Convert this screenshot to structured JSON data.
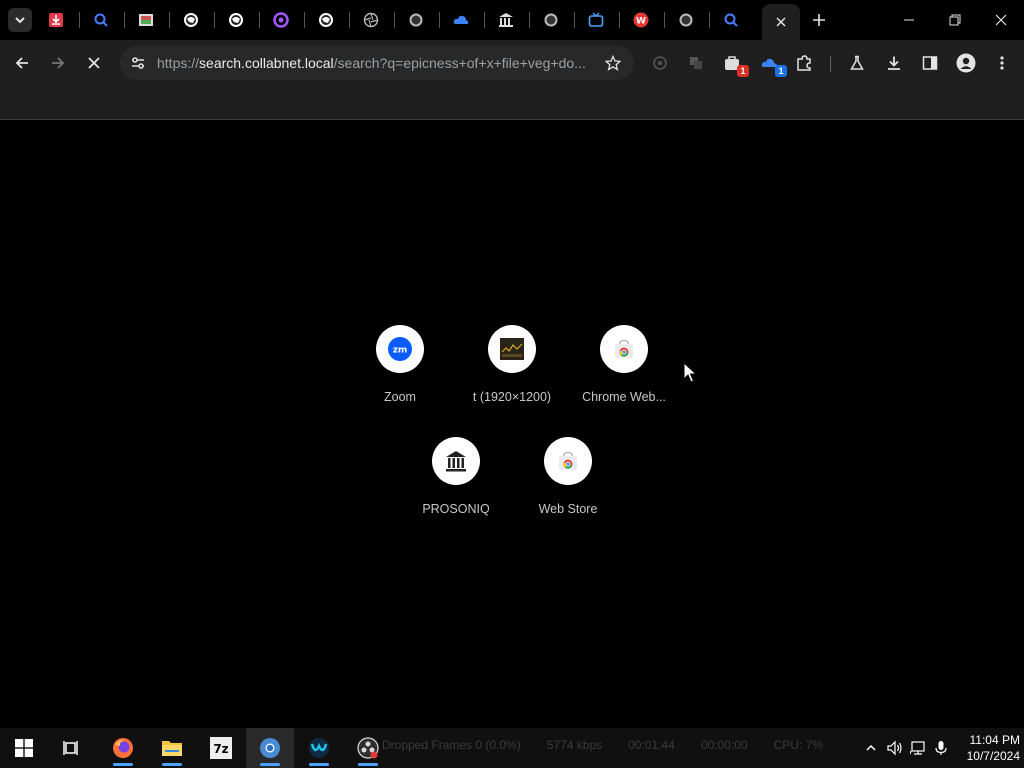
{
  "tabs": {
    "search_tabs_label": "Search tabs",
    "items": [
      {
        "icon": "download-red-icon"
      },
      {
        "icon": "magnifier-icon"
      },
      {
        "icon": "image-thumb-icon"
      },
      {
        "icon": "globe-icon"
      },
      {
        "icon": "globe-icon"
      },
      {
        "icon": "purple-ring-icon"
      },
      {
        "icon": "globe-icon"
      },
      {
        "icon": "aperture-icon"
      },
      {
        "icon": "globe-icon"
      },
      {
        "icon": "cloud-icon"
      },
      {
        "icon": "museum-icon"
      },
      {
        "icon": "globe-icon"
      },
      {
        "icon": "tv-icon"
      },
      {
        "icon": "red-w-icon"
      },
      {
        "icon": "globe-icon"
      },
      {
        "icon": "magnifier-icon"
      }
    ],
    "active_tab_icon": "close-icon"
  },
  "toolbar": {
    "url_scheme": "https://",
    "url_host": "search.collabnet.local",
    "url_rest": "/search?q=epicness+of+x+file+veg+do...",
    "extension_badge_1": "1",
    "extension_badge_2": "1"
  },
  "shortcuts": [
    {
      "label": "Zoom",
      "icon": "zoom-icon"
    },
    {
      "label": "t (1920×1200)",
      "icon": "thumbnail-icon"
    },
    {
      "label": "Chrome Web...",
      "icon": "chrome-web-store-icon"
    },
    {
      "label": "PROSONIQ",
      "icon": "museum-icon"
    },
    {
      "label": "Web Store",
      "icon": "chrome-web-store-icon"
    }
  ],
  "taskbar": {
    "obs_status": {
      "dropped": "Dropped Frames 0 (0.0%)",
      "bitrate": "5774 kbps",
      "time": "00:01:44",
      "rec": "00:00:00",
      "cpu": "CPU: 7%"
    },
    "clock_time": "11:04 PM",
    "clock_date": "10/7/2024"
  },
  "colors": {
    "accent": "#4aa3ff",
    "toolbar_bg": "#1f1f1f",
    "content_bg": "#000000"
  }
}
